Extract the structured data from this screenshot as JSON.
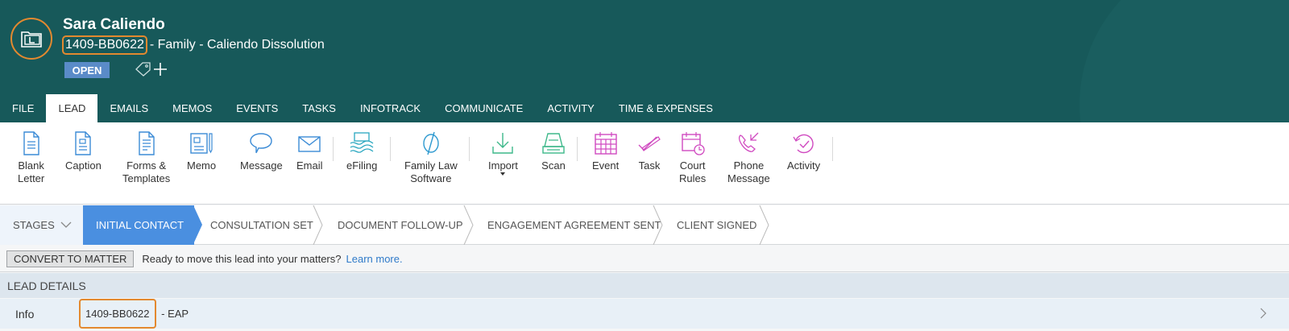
{
  "header": {
    "client_name": "Sara Caliendo",
    "matter_id": "1409-BB0622",
    "matter_desc": "- Family - Caliendo Dissolution",
    "status": "OPEN",
    "colors": {
      "header_bg": "#17595a",
      "highlight": "#e3892f",
      "badge": "#5a8bc8"
    }
  },
  "tabs": [
    {
      "label": "FILE",
      "active": false
    },
    {
      "label": "LEAD",
      "active": true
    },
    {
      "label": "EMAILS",
      "active": false
    },
    {
      "label": "MEMOS",
      "active": false
    },
    {
      "label": "EVENTS",
      "active": false
    },
    {
      "label": "TASKS",
      "active": false
    },
    {
      "label": "INFOTRACK",
      "active": false
    },
    {
      "label": "COMMUNICATE",
      "active": false
    },
    {
      "label": "ACTIVITY",
      "active": false
    },
    {
      "label": "TIME & EXPENSES",
      "active": false
    }
  ],
  "ribbon": [
    {
      "label": "Blank\nLetter",
      "icon": "document-icon"
    },
    {
      "label": "Caption",
      "icon": "caption-document-icon"
    },
    {
      "label": "Forms &\nTemplates",
      "icon": "forms-document-icon"
    },
    {
      "label": "Memo",
      "icon": "memo-icon"
    },
    {
      "label": "Message",
      "icon": "speech-bubble-icon"
    },
    {
      "label": "Email",
      "icon": "envelope-icon"
    },
    {
      "label": "eFiling",
      "icon": "efiling-icon"
    },
    {
      "label": "Family Law\nSoftware",
      "icon": "family-law-icon"
    },
    {
      "label": "Import",
      "icon": "download-icon"
    },
    {
      "label": "Scan",
      "icon": "scanner-icon"
    },
    {
      "label": "Event",
      "icon": "calendar-icon"
    },
    {
      "label": "Task",
      "icon": "task-check-icon"
    },
    {
      "label": "Court\nRules",
      "icon": "court-rules-calendar-icon"
    },
    {
      "label": "Phone\nMessage",
      "icon": "phone-message-icon"
    },
    {
      "label": "Activity",
      "icon": "activity-icon"
    }
  ],
  "stages": {
    "menu_label": "STAGES",
    "items": [
      "INITIAL CONTACT",
      "CONSULTATION SET",
      "DOCUMENT FOLLOW-UP",
      "ENGAGEMENT AGREEMENT SENT",
      "CLIENT SIGNED"
    ],
    "active": "INITIAL CONTACT"
  },
  "convert": {
    "button_label": "CONVERT TO MATTER",
    "message": "Ready to move this lead into your matters?",
    "link": "Learn more."
  },
  "details": {
    "heading": "LEAD DETAILS",
    "info_label": "Info",
    "info_id": "1409-BB0622",
    "info_suffix": " - EAP"
  }
}
